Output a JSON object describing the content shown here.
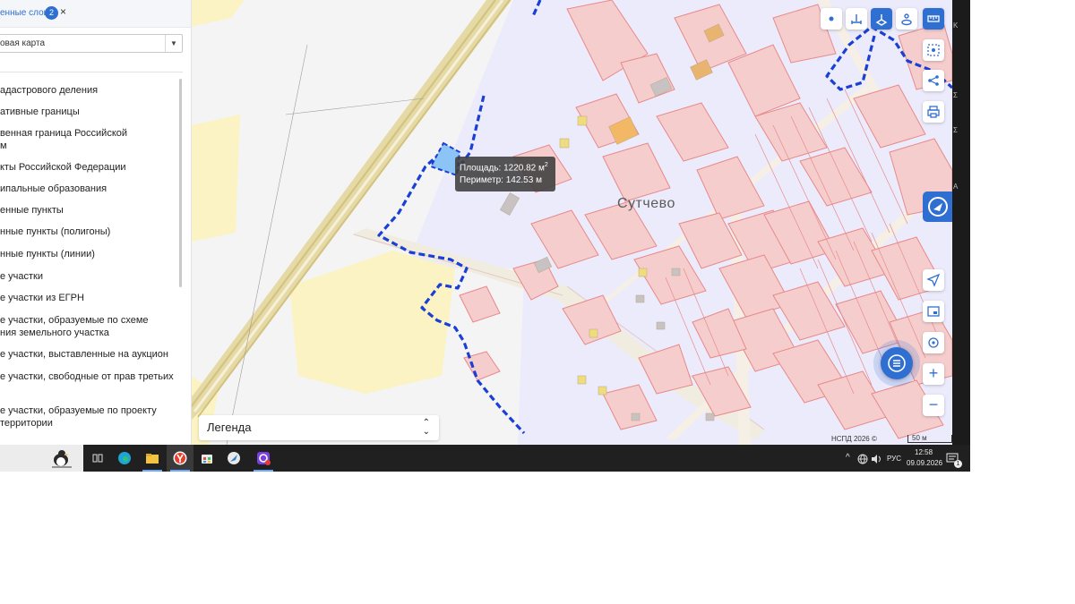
{
  "layers_panel": {
    "title_fragment": "енные слои",
    "badge_count": "2",
    "close_glyph": "×",
    "basemap_value": "овая карта",
    "layers": [
      "адастрового деления",
      "ативные границы",
      "венная граница Российской",
      "м",
      "кты Российской Федерации",
      "ипальные образования",
      "енные пункты",
      "нные пункты (полигоны)",
      "нные пункты (линии)",
      "е участки",
      "е участки из ЕГРН",
      "е участки, образуемые по схеме",
      "ния земельного участка",
      "е участки, выставленные на аукцион",
      "е участки, свободные от прав третьих",
      "е участки, образуемые по проекту",
      "территории"
    ]
  },
  "map": {
    "tooltip": {
      "area_text": "Площадь: 1220.82 м",
      "area_sup": "2",
      "perimeter_text": "Периметр: 142.53 м"
    },
    "place_label": "Сутчево",
    "legend_label": "Легенда",
    "legend_toggle": "⌃⌄",
    "attribution": "НСПД 2026 ©",
    "scale_label": "50 м",
    "colors": {
      "parcel_fill": "#f6cdcd",
      "parcel_stroke": "#e78a8a",
      "boundary_dash": "#1a3fd4",
      "road": "#f3ecd7",
      "highway_border": "#d9c98d",
      "field_yellow": "#fbf3c3",
      "accent": "#2f6fd1"
    }
  },
  "toolbar": {
    "top_row": [
      "point-tool",
      "distance-tool",
      "area-tool",
      "height-tool",
      "ruler-tool"
    ],
    "side_column": [
      "select-area-tool",
      "share",
      "print"
    ],
    "lower_column": [
      "locate",
      "minimap",
      "location-search"
    ],
    "zoom_in_glyph": "+",
    "zoom_out_glyph": "−"
  },
  "taskbar": {
    "lang": "РУС",
    "time": "12:58",
    "date": "09.09.2026",
    "notification_count": "1",
    "chevron_glyph": "^"
  },
  "edge_glyphs": [
    "K",
    "Σ",
    "Σ",
    "A"
  ]
}
